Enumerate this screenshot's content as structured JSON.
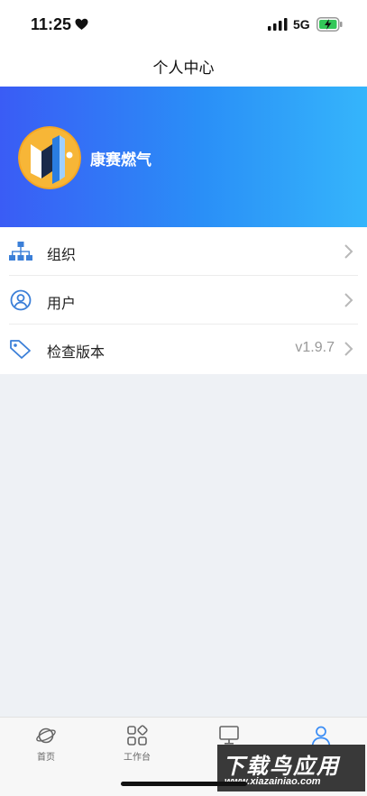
{
  "status_bar": {
    "time": "11:25",
    "network": "5G"
  },
  "nav": {
    "title": "个人中心"
  },
  "profile": {
    "company_name": "康赛燃气"
  },
  "menu": {
    "items": [
      {
        "label": "组织",
        "icon": "org-chart-icon"
      },
      {
        "label": "用户",
        "icon": "user-icon"
      },
      {
        "label": "检查版本",
        "icon": "tag-icon",
        "value": "v1.9.7"
      }
    ]
  },
  "tab_bar": {
    "tabs": [
      {
        "label": "首页",
        "icon": "planet-icon"
      },
      {
        "label": "工作台",
        "icon": "grid-icon"
      },
      {
        "label": "",
        "icon": "monitor-icon"
      },
      {
        "label": "",
        "icon": "person-icon",
        "active": true
      }
    ]
  },
  "watermark": {
    "main": "下载鸟应用",
    "url": "www.xiazainiao.com"
  },
  "colors": {
    "banner_start": "#3a5cf5",
    "banner_end": "#35b5fb",
    "icon_blue": "#3b7fd8",
    "active_tab": "#3b8df5"
  }
}
